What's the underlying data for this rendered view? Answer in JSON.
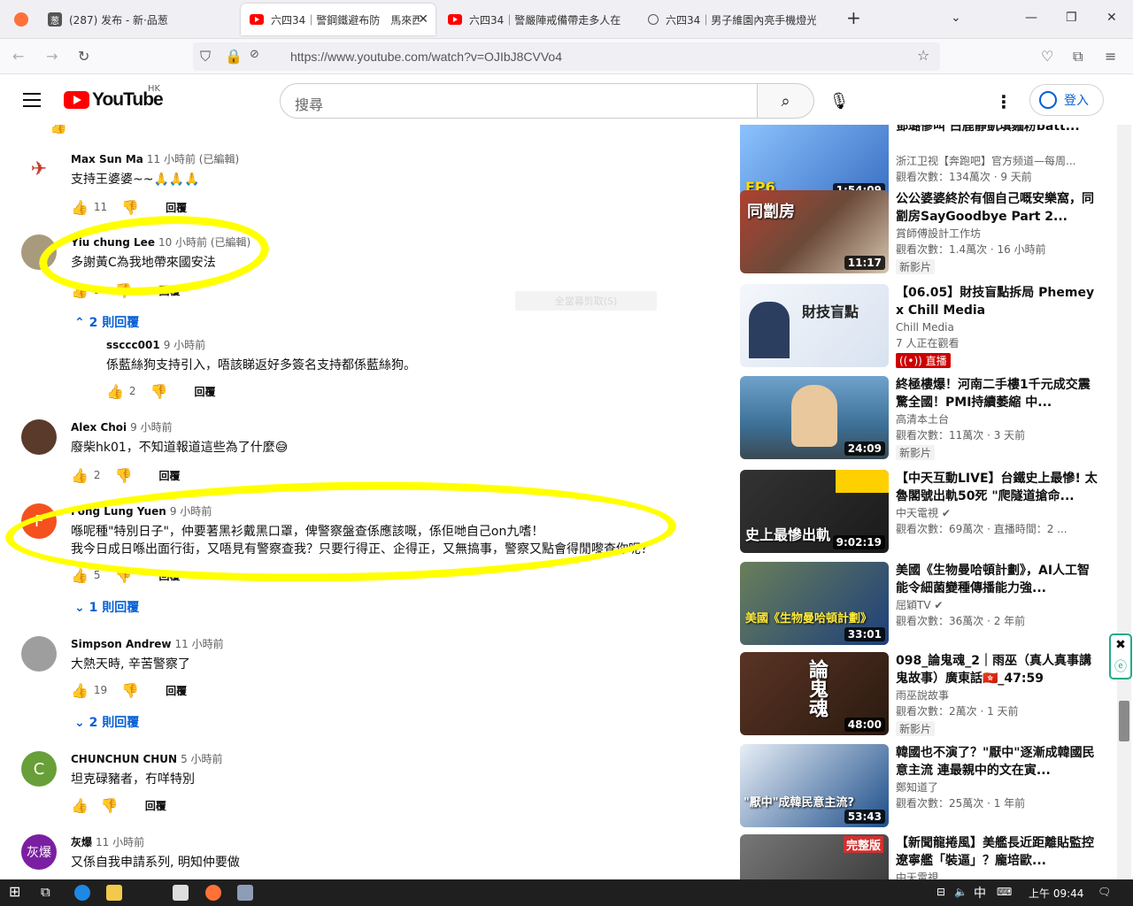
{
  "browser": {
    "tabs": [
      {
        "title": "(287) 发布 - 新·品葱",
        "active": false
      },
      {
        "title": "六四34｜警鋼鐵避布防　馬來西",
        "active": true
      },
      {
        "title": "六四34｜警嚴陣戒備帶走多人在",
        "active": false
      },
      {
        "title": "六四34｜男子維園內亮手機燈光",
        "active": false
      }
    ],
    "new_tab": "+",
    "url": "https://www.youtube.com/watch?v=OJIbJ8CVVo4"
  },
  "youtube": {
    "logo": "YouTube",
    "region": "HK",
    "search_placeholder": "搜尋",
    "sign_in": "登入"
  },
  "comments": [
    {
      "author": "Max Sun Ma",
      "time": "11 小時前 (已編輯)",
      "text": "支持王婆婆~~🙏🙏🙏",
      "likes": "11",
      "reply": "回覆",
      "avatar_color": "#c0392b",
      "avatar_letter": ""
    },
    {
      "author": "Yiu chung Lee",
      "time": "10 小時前 (已編輯)",
      "text": "多謝黃C為我地帶來國安法",
      "likes": "9",
      "reply": "回覆",
      "avatar_color": "#a89a7c",
      "avatar_letter": "",
      "replies_toggle": "2 則回覆"
    },
    {
      "author": "ssccc001",
      "time": "9 小時前",
      "text": "係藍絲狗支持引入，唔該睇返好多簽名支持都係藍絲狗。",
      "likes": "2",
      "reply": "回覆"
    },
    {
      "author": "Alex Choi",
      "time": "9 小時前",
      "text": "廢柴hk01，不知道報道這些為了什麼😅",
      "likes": "2",
      "reply": "回覆",
      "avatar_color": "#5a3a2a",
      "avatar_letter": ""
    },
    {
      "author": "Fong Lung Yuen",
      "time": "9 小時前",
      "text_lines": [
        "喺呢種\"特別日子\"，仲要著黑衫戴黑口罩，俾警察盤查係應該嘅，係佢哋自己on九嗜！",
        "我今日成日喺出面行街，又唔見有警察查我？只要行得正、企得正，又無搞事，警察又點會得閒嚟查你呢？"
      ],
      "likes": "5",
      "reply": "回覆",
      "avatar_color": "#f4511e",
      "avatar_letter": "F",
      "replies_toggle": "1 則回覆"
    },
    {
      "author": "Simpson Andrew",
      "time": "11 小時前",
      "text": "大熱天時, 辛苦警察了",
      "likes": "19",
      "reply": "回覆",
      "avatar_color": "#9e9e9e",
      "avatar_letter": "",
      "replies_toggle": "2 則回覆"
    },
    {
      "author": "CHUNCHUN CHUN",
      "time": "5 小時前",
      "text": "坦克碌豬者，冇咩特別",
      "likes": "",
      "reply": "回覆",
      "avatar_color": "#689f38",
      "avatar_letter": "C"
    },
    {
      "author": "灰爆",
      "time": "11 小時前",
      "text": "又係自我申請系列, 明知仲要做",
      "likes": "",
      "reply": "回覆",
      "avatar_color": "#7b1fa2",
      "avatar_letter": "灰爆"
    }
  ],
  "collapsed_hint": "全當幕剪取(S)",
  "sidebar": [
    {
      "title": "鄧璐慘叫 白鹿靜凱填麵粉batt...",
      "channel": "浙江卫视【奔跑吧】官方频道—每周...",
      "stats": "觀看次數：134萬次 · 9 天前",
      "duration": "1:54:09",
      "thumb_bg": "#3a6fc4",
      "thumb_text": "EP6"
    },
    {
      "title": "公公婆婆終於有個自己嘅安樂窩，同劏房SayGoodbye Part 2...",
      "channel": "賞師傅設計工作坊",
      "stats": "觀看次數：1.4萬次 · 16 小時前",
      "badge": "新影片",
      "duration": "11:17",
      "thumb_bg": "#7a5a4a",
      "thumb_text": "同劏房"
    },
    {
      "title": "【06.05】財技盲點拆局 Phemey x Chill Media",
      "channel": "Chill Media",
      "stats": "7 人正在觀看",
      "live": "直播",
      "duration": "",
      "thumb_bg": "#e8eef6",
      "thumb_text": "財技盲點"
    },
    {
      "title": "終極樓爆！河南二手樓1千元成交震驚全國！PMI持續萎縮 中...",
      "channel": "高清本土台",
      "stats": "觀看次數：11萬次 · 3 天前",
      "badge": "新影片",
      "duration": "24:09",
      "thumb_bg": "#4a7ea8",
      "thumb_text": ""
    },
    {
      "title": "【中天互動LIVE】台鐵史上最慘! 太魯閣號出軌50死 \"爬隧道搶命...",
      "channel": "中天電視 ✔",
      "stats": "觀看次數：69萬次 · 直播時間：2 ...",
      "duration": "9:02:19",
      "thumb_bg": "#2b2b2b",
      "thumb_text": "史上最慘出軌"
    },
    {
      "title": "美國《生物曼哈頓計劃》，AI人工智能令細菌變種傳播能力強...",
      "channel": "屈穎TV ✔",
      "stats": "觀看次數：36萬次 · 2 年前",
      "duration": "33:01",
      "thumb_bg": "#1d3f7a",
      "thumb_text": "美國《生物曼哈頓計劃》"
    },
    {
      "title": "098_論鬼魂_2｜雨巫（真人真事講鬼故事）廣東話🇭🇰_47:59",
      "channel": "雨巫說故事",
      "stats": "觀看次數：2萬次 · 1 天前",
      "badge": "新影片",
      "duration": "48:00",
      "thumb_bg": "#3a2418",
      "thumb_text": "論鬼魂"
    },
    {
      "title": "韓國也不演了？\"厭中\"逐漸成韓國民意主流 連最親中的文在寅...",
      "channel": "鄭知道了",
      "stats": "觀看次數：25萬次 · 1 年前",
      "duration": "53:43",
      "thumb_bg": "#1c4e8a",
      "thumb_text": "\"厭中\"成韓民意主流?"
    },
    {
      "title": "【新聞龍捲風】美艦長近距離貼監控遼寧艦「裝逼」？龐培歐...",
      "channel": "中天電視",
      "stats": "",
      "duration": "",
      "thumb_bg": "#5a5a5a",
      "thumb_text": "完整版"
    }
  ],
  "taskbar": {
    "ime": "中",
    "time": "上午 09:44"
  }
}
